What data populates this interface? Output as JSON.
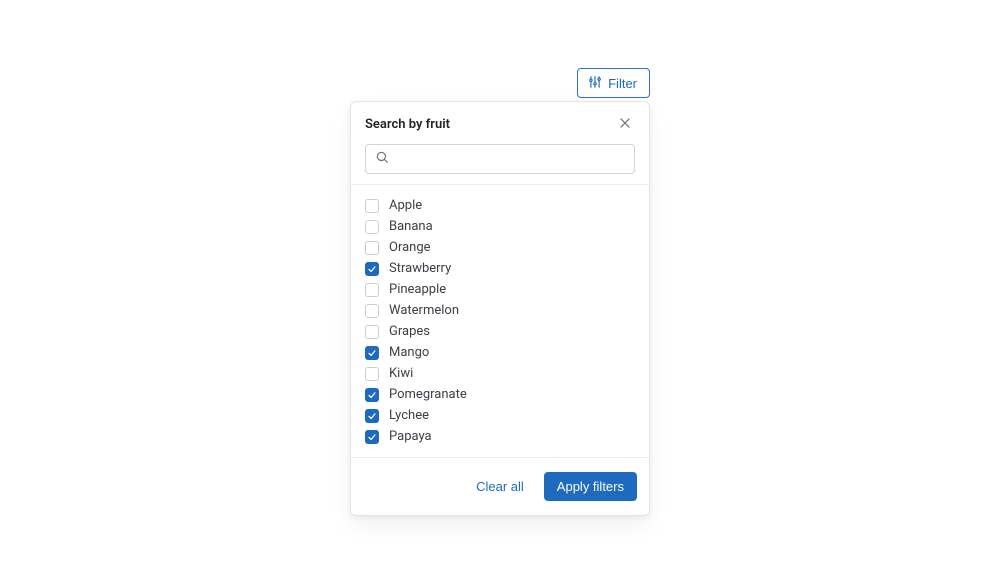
{
  "trigger": {
    "label": "Filter"
  },
  "panel": {
    "title": "Search by fruit",
    "search_placeholder": "",
    "search_value": "",
    "clear_label": "Clear all",
    "apply_label": "Apply filters"
  },
  "items": [
    {
      "label": "Apple",
      "checked": false
    },
    {
      "label": "Banana",
      "checked": false
    },
    {
      "label": "Orange",
      "checked": false
    },
    {
      "label": "Strawberry",
      "checked": true
    },
    {
      "label": "Pineapple",
      "checked": false
    },
    {
      "label": "Watermelon",
      "checked": false
    },
    {
      "label": "Grapes",
      "checked": false
    },
    {
      "label": "Mango",
      "checked": true
    },
    {
      "label": "Kiwi",
      "checked": false
    },
    {
      "label": "Pomegranate",
      "checked": true
    },
    {
      "label": "Lychee",
      "checked": true
    },
    {
      "label": "Papaya",
      "checked": true
    }
  ]
}
